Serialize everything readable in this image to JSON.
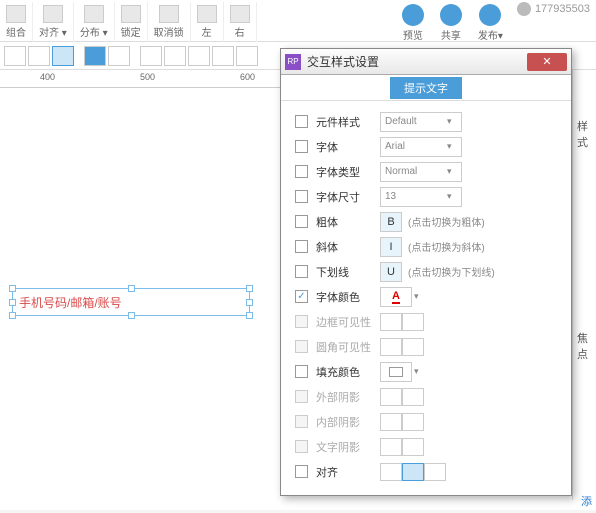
{
  "toolbar": {
    "groups": [
      {
        "label": "组合",
        "icon": ""
      },
      {
        "label": "对齐 ▾",
        "icon": ""
      },
      {
        "label": "分布 ▾",
        "icon": ""
      },
      {
        "label": "锁定",
        "icon": ""
      },
      {
        "label": "取消锁",
        "icon": ""
      },
      {
        "label": "左",
        "icon": ""
      },
      {
        "label": "右",
        "icon": ""
      }
    ],
    "right": [
      {
        "label": "预览"
      },
      {
        "label": "共享"
      },
      {
        "label": "发布▾"
      }
    ],
    "user": "177935503"
  },
  "ruler": {
    "marks": [
      "400",
      "500",
      "600"
    ]
  },
  "selection": {
    "placeholder": "手机号码/邮箱/账号"
  },
  "dialog": {
    "title": "交互样式设置",
    "tab": "提示文字",
    "rows": [
      {
        "k": "style",
        "chk": false,
        "label": "元件样式",
        "ctrl": "Default",
        "type": "select"
      },
      {
        "k": "font",
        "chk": false,
        "label": "字体",
        "ctrl": "Arial",
        "type": "select"
      },
      {
        "k": "ftype",
        "chk": false,
        "label": "字体类型",
        "ctrl": "Normal",
        "type": "select"
      },
      {
        "k": "fsize",
        "chk": false,
        "label": "字体尺寸",
        "ctrl": "13",
        "type": "select"
      },
      {
        "k": "bold",
        "chk": false,
        "label": "粗体",
        "hint": "(点击切换为粗体)",
        "type": "toggle",
        "glyph": "B"
      },
      {
        "k": "italic",
        "chk": false,
        "label": "斜体",
        "hint": "(点击切换为斜体)",
        "type": "toggle",
        "glyph": "I"
      },
      {
        "k": "under",
        "chk": false,
        "label": "下划线",
        "hint": "(点击切换为下划线)",
        "type": "toggle",
        "glyph": "U"
      },
      {
        "k": "fcolor",
        "chk": true,
        "label": "字体颜色",
        "type": "color"
      },
      {
        "k": "bvis",
        "chk": false,
        "disabled": true,
        "label": "边框可见性",
        "type": "seg"
      },
      {
        "k": "cvis",
        "chk": false,
        "disabled": true,
        "label": "圆角可见性",
        "type": "seg"
      },
      {
        "k": "fill",
        "chk": false,
        "label": "填充颜色",
        "type": "fill"
      },
      {
        "k": "oshad",
        "chk": false,
        "disabled": true,
        "label": "外部阴影",
        "type": "seg"
      },
      {
        "k": "ishad",
        "chk": false,
        "disabled": true,
        "label": "内部阴影",
        "type": "seg"
      },
      {
        "k": "tshad",
        "chk": false,
        "disabled": true,
        "label": "文字阴影",
        "type": "seg"
      },
      {
        "k": "align",
        "chk": false,
        "label": "对齐",
        "type": "align"
      }
    ]
  },
  "rightPanel": {
    "label1": "样式",
    "label2": "焦点",
    "link": "添"
  }
}
